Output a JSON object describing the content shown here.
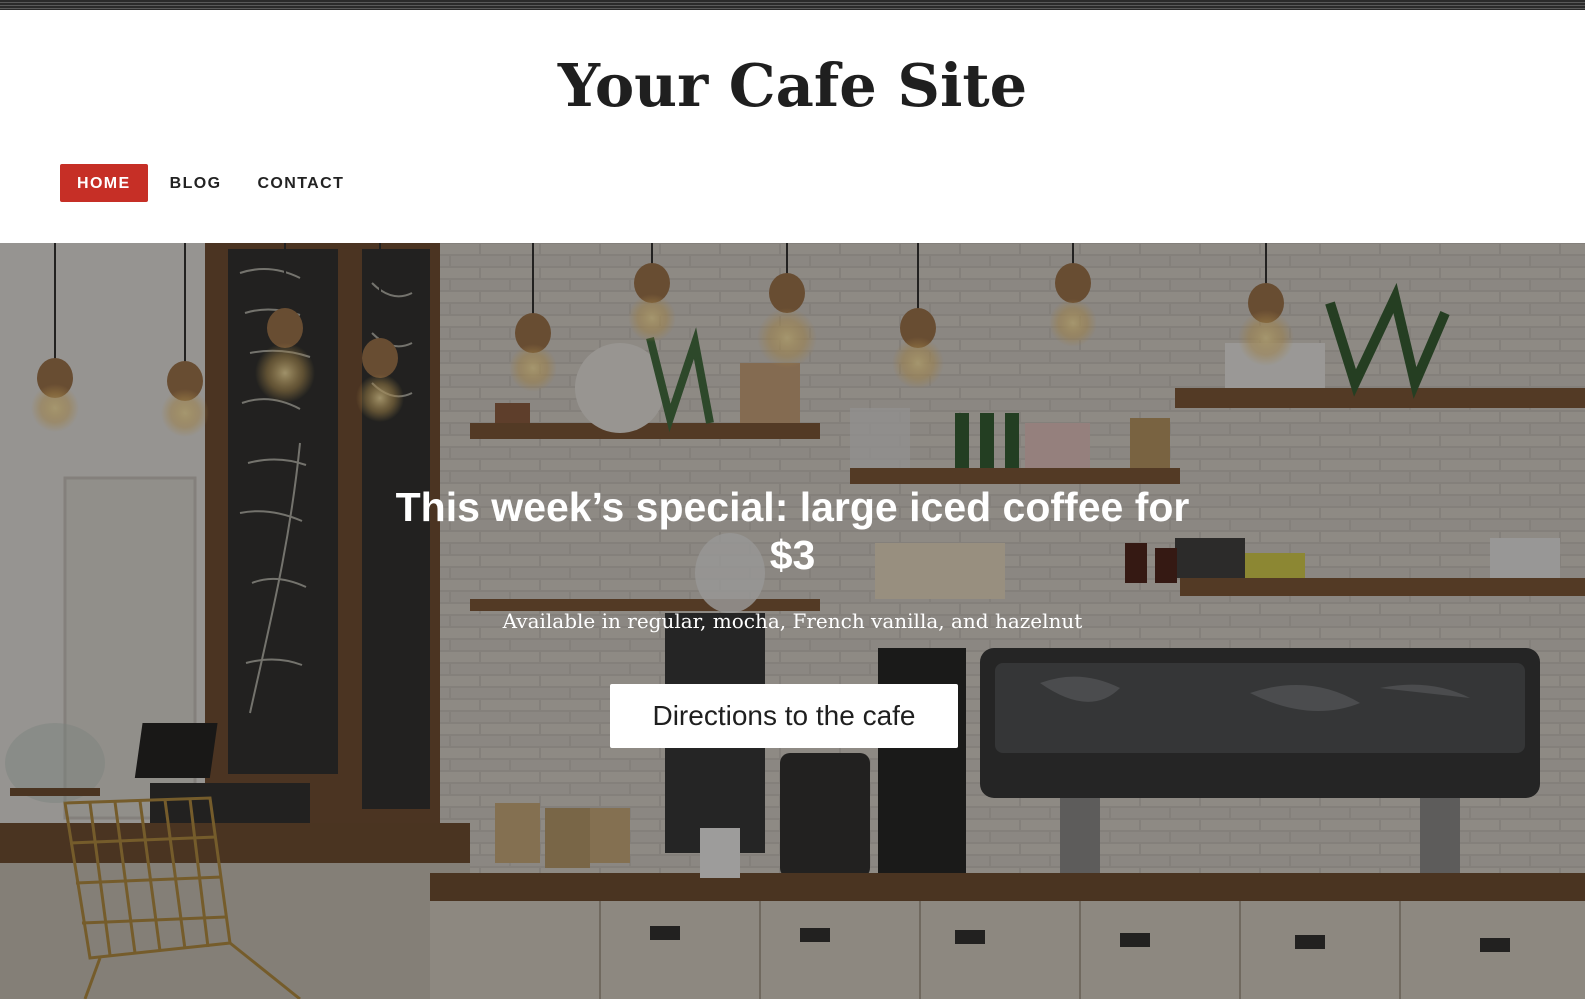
{
  "site": {
    "title": "Your Cafe Site"
  },
  "nav": {
    "items": [
      {
        "label": "HOME",
        "active": true
      },
      {
        "label": "BLOG",
        "active": false
      },
      {
        "label": "CONTACT",
        "active": false
      }
    ]
  },
  "hero": {
    "heading": "This week’s special: large iced coffee for $3",
    "subheading": "Available in regular, mocha, French vanilla, and hazelnut",
    "button_label": "Directions to the cafe",
    "background_description_icon": "cafe-interior-photo"
  },
  "colors": {
    "accent": "#c62f26",
    "title_text": "#1f1f1f",
    "hero_text": "#ffffff"
  }
}
